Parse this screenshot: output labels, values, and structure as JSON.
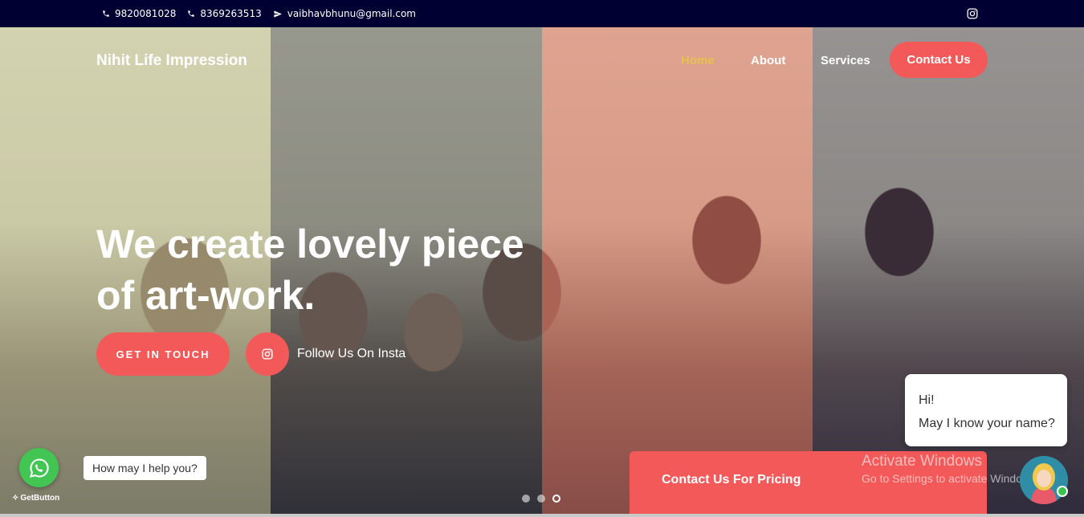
{
  "topbar": {
    "phone1": "9820081028",
    "phone2": "8369263513",
    "email": "vaibhavbhunu@gmail.com",
    "icons": {
      "phone": "phone-icon",
      "email": "paper-plane-icon",
      "social": "instagram-icon"
    }
  },
  "header": {
    "brand": "Nihit Life Impression",
    "nav": {
      "home": "Home",
      "about": "About",
      "services": "Services",
      "contact": "Contact Us"
    }
  },
  "hero": {
    "headline_line1": "We create lovely piece",
    "headline_line2": "of art-work.",
    "cta_label": "GET IN TOUCH",
    "insta_label": "Follow Us On Insta",
    "slider_dots": 3,
    "active_slide": 3
  },
  "pricing_bar": {
    "label": "Contact Us For Pricing"
  },
  "chat_widget": {
    "line1": "Hi!",
    "line2": "May I know your name?"
  },
  "whatsapp": {
    "tooltip": "How may I help you?",
    "powered_by": "GetButton"
  },
  "watermark": {
    "title": "Activate Windows",
    "subtitle": "Go to Settings to activate Windows."
  },
  "colors": {
    "topbar_bg": "#000033",
    "accent": "#f4595a",
    "nav_active": "#e8c24a",
    "whatsapp_green": "#43c553"
  }
}
